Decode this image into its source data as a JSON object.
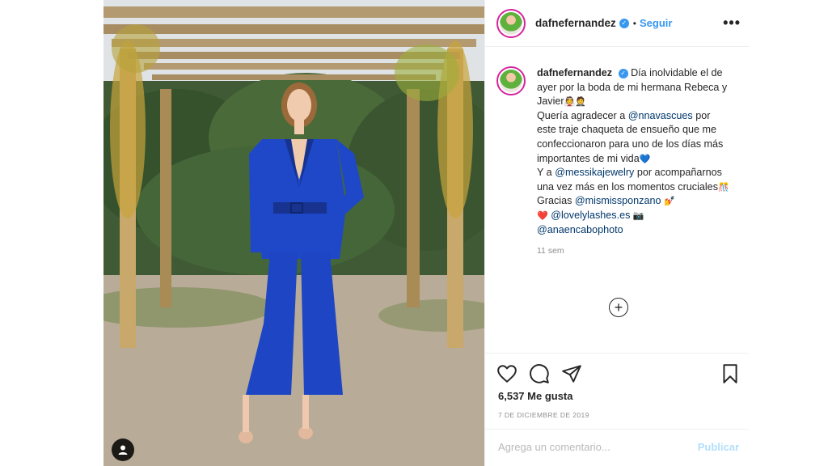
{
  "post": {
    "username": "dafnefernandez",
    "verified_icon": "verified-badge-icon",
    "separator": "•",
    "follow_label": "Seguir",
    "more_label": "•••",
    "caption": {
      "username": "dafnefernandez",
      "line1": "Día inolvidable el de ayer por la boda de mi hermana Rebeca y Javier",
      "emoji1": "👰🤵",
      "line2": "Quería agradecer a",
      "mention1": "@nnavascues",
      "line3": "por este traje chaqueta de ensueño que me confeccionaron para uno de los días más importantes de mi vida",
      "emoji2": "💙",
      "line4": "Y a",
      "mention2": "@messikajewelry",
      "line5": "por acompañarnos una vez más en los momentos cruciales",
      "emoji3": "🎊",
      "line6": "Gracias",
      "mention3": "@mismissponzano",
      "emoji4": "💅",
      "emoji5": "❤️",
      "mention4": "@lovelylashes.es",
      "emoji6": "📷",
      "mention5": "@anaencabophoto"
    },
    "time_ago": "11 sem",
    "likes": "6,537 Me gusta",
    "date": "7 DE DICIEMBRE DE 2019",
    "comment_placeholder": "Agrega un comentario...",
    "publish_label": "Publicar",
    "icons": {
      "like": "heart-icon",
      "comment": "comment-icon",
      "share": "share-icon",
      "save": "bookmark-icon",
      "add": "plus-circle-icon",
      "user_tag": "user-tag-icon"
    },
    "colors": {
      "accent": "#3897f0",
      "suit": "#1f48c8"
    }
  }
}
